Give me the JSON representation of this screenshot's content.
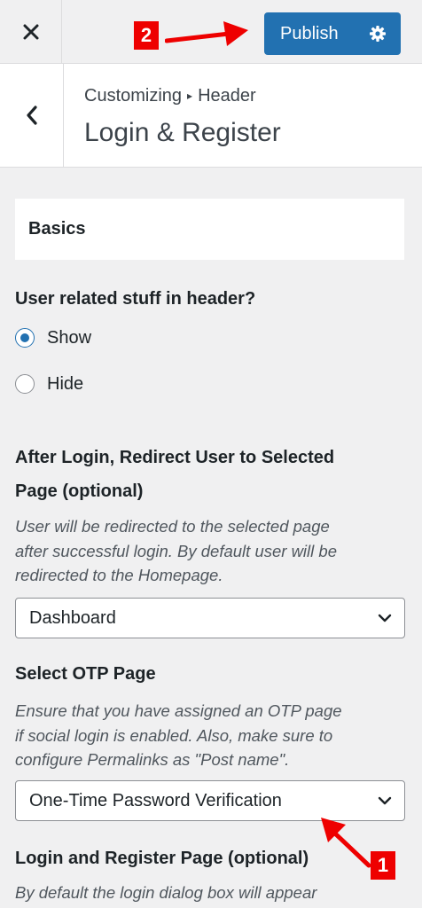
{
  "topbar": {
    "close_icon": "close-icon",
    "publish_label": "Publish",
    "settings_icon": "gear-icon",
    "accent_color": "#2271b1"
  },
  "annotations": {
    "badge_2": "2",
    "badge_1": "1",
    "arrow_color": "#ee0000"
  },
  "panel_header": {
    "back_icon": "chevron-left-icon",
    "breadcrumb_parent": "Customizing",
    "breadcrumb_separator": "▸",
    "breadcrumb_current": "Header",
    "title": "Login & Register"
  },
  "sections": {
    "basics_title": "Basics"
  },
  "user_stuff": {
    "label": "User related stuff in header?",
    "options": [
      {
        "label": "Show",
        "selected": true
      },
      {
        "label": "Hide",
        "selected": false
      }
    ]
  },
  "redirect": {
    "label_line1": "After Login, Redirect User to Selected",
    "label_line2": "Page (optional)",
    "description_lines": [
      "User will be redirected to the selected page",
      "after successful login. By default user will be",
      "redirected to the Homepage."
    ],
    "selected_value": "Dashboard"
  },
  "otp": {
    "label": "Select OTP Page",
    "description_lines": [
      "Ensure that you have assigned an OTP page",
      "if social login is enabled. Also, make sure to",
      "configure Permalinks as \"Post name\"."
    ],
    "selected_value": "One-Time Password Verification"
  },
  "login_register_page": {
    "label": "Login and Register Page (optional)",
    "description_partial": "By default the login dialog box will appear"
  }
}
